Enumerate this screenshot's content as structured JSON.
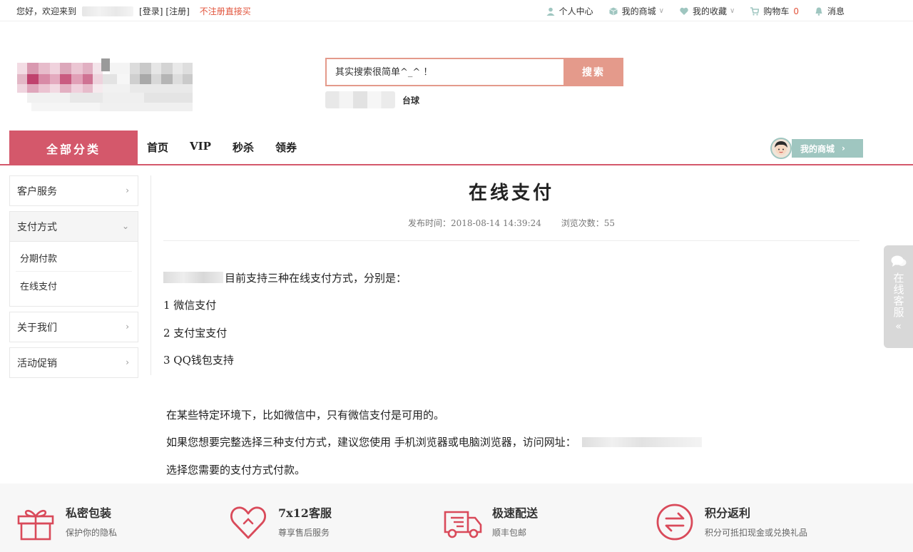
{
  "topbar": {
    "greeting": "您好，欢迎来到",
    "login": "[登录]",
    "register": "[注册]",
    "no_register_buy": "不注册直接买",
    "user_center": "个人中心",
    "my_mall": "我的商城",
    "my_favorites": "我的收藏",
    "cart": "购物车",
    "cart_count": "0",
    "messages": "消息"
  },
  "search": {
    "placeholder": "其实搜索很简单^_^ ！",
    "button": "搜索",
    "hot_word": "台球"
  },
  "nav": {
    "all_categories": "全部分类",
    "links": [
      "首页",
      "VIP",
      "秒杀",
      "领券"
    ],
    "my_mall": "我的商城"
  },
  "sidebar": {
    "items": [
      {
        "label": "客户服务"
      },
      {
        "label": "支付方式",
        "children": [
          "分期付款",
          "在线支付"
        ]
      },
      {
        "label": "关于我们"
      },
      {
        "label": "活动促销"
      }
    ]
  },
  "article": {
    "title": "在线支付",
    "publish_time": "发布时间：2018-08-14 14:39:24",
    "views": "浏览次数：55",
    "intro": "目前支持三种在线支付方式，分别是：",
    "methods": [
      "1  微信支付",
      "2  支付宝支付",
      "3  QQ钱包支持"
    ],
    "p1": "在某些特定环境下，比如微信中，只有微信支付是可用的。",
    "p2": "如果您想要完整选择三种支付方式，建议您使用 手机浏览器或电脑浏览器，访问网址：",
    "p3": "选择您需要的支付方式付款。"
  },
  "float_service": {
    "label": "在线客服",
    "collapse": "«"
  },
  "features": [
    {
      "title": "私密包装",
      "subtitle": "保护你的隐私",
      "icon": "gift-icon"
    },
    {
      "title": "7x12客服",
      "subtitle": "尊享售后服务",
      "icon": "heart-icon"
    },
    {
      "title": "极速配送",
      "subtitle": "顺丰包邮",
      "icon": "truck-icon"
    },
    {
      "title": "积分返利",
      "subtitle": "积分可抵扣现金或兑换礼品",
      "icon": "exchange-icon"
    }
  ],
  "colors": {
    "brand": "#d4586b",
    "search": "#e49a8b",
    "accent_red": "#e2543c",
    "teal": "#9fc6c0"
  }
}
